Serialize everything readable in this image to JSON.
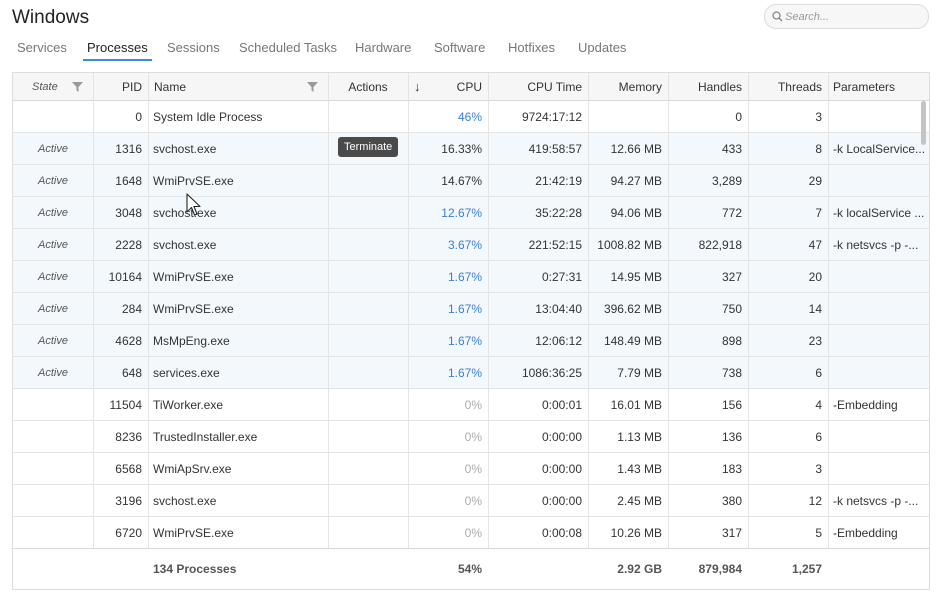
{
  "page": {
    "title": "Windows"
  },
  "search": {
    "placeholder": "Search..."
  },
  "tabs": [
    {
      "label": "Services",
      "active": false
    },
    {
      "label": "Processes",
      "active": true
    },
    {
      "label": "Sessions",
      "active": false
    },
    {
      "label": "Scheduled Tasks",
      "active": false
    },
    {
      "label": "Hardware",
      "active": false
    },
    {
      "label": "Software",
      "active": false
    },
    {
      "label": "Hotfixes",
      "active": false
    },
    {
      "label": "Updates",
      "active": false
    }
  ],
  "table": {
    "headers": {
      "state": "State",
      "pid": "PID",
      "name": "Name",
      "actions": "Actions",
      "sort_indicator": "↓",
      "cpu": "CPU",
      "cpu_time": "CPU Time",
      "memory": "Memory",
      "handles": "Handles",
      "threads": "Threads",
      "parameters": "Parameters"
    },
    "sort": {
      "column": "cpu",
      "direction": "descending"
    },
    "rows": [
      {
        "state": "",
        "pid": "0",
        "name": "System Idle Process",
        "cpu": "46%",
        "cpu_time": "9724:17:12",
        "memory": "",
        "handles": "0",
        "threads": "3",
        "parameters": ""
      },
      {
        "state": "Active",
        "pid": "1316",
        "name": "svchost.exe",
        "cpu": "16.33%",
        "cpu_time": "419:58:57",
        "memory": "12.66 MB",
        "handles": "433",
        "threads": "8",
        "parameters": "-k LocalService..."
      },
      {
        "state": "Active",
        "pid": "1648",
        "name": "WmiPrvSE.exe",
        "cpu": "14.67%",
        "cpu_time": "21:42:19",
        "memory": "94.27 MB",
        "handles": "3,289",
        "threads": "29",
        "parameters": ""
      },
      {
        "state": "Active",
        "pid": "3048",
        "name": "svchost.exe",
        "cpu": "12.67%",
        "cpu_time": "35:22:28",
        "memory": "94.06 MB",
        "handles": "772",
        "threads": "7",
        "parameters": "-k localService ..."
      },
      {
        "state": "Active",
        "pid": "2228",
        "name": "svchost.exe",
        "cpu": "3.67%",
        "cpu_time": "221:52:15",
        "memory": "1008.82 MB",
        "handles": "822,918",
        "threads": "47",
        "parameters": "-k netsvcs -p -..."
      },
      {
        "state": "Active",
        "pid": "10164",
        "name": "WmiPrvSE.exe",
        "cpu": "1.67%",
        "cpu_time": "0:27:31",
        "memory": "14.95 MB",
        "handles": "327",
        "threads": "20",
        "parameters": ""
      },
      {
        "state": "Active",
        "pid": "284",
        "name": "WmiPrvSE.exe",
        "cpu": "1.67%",
        "cpu_time": "13:04:40",
        "memory": "396.62 MB",
        "handles": "750",
        "threads": "14",
        "parameters": ""
      },
      {
        "state": "Active",
        "pid": "4628",
        "name": "MsMpEng.exe",
        "cpu": "1.67%",
        "cpu_time": "12:06:12",
        "memory": "148.49 MB",
        "handles": "898",
        "threads": "23",
        "parameters": ""
      },
      {
        "state": "Active",
        "pid": "648",
        "name": "services.exe",
        "cpu": "1.67%",
        "cpu_time": "1086:36:25",
        "memory": "7.79 MB",
        "handles": "738",
        "threads": "6",
        "parameters": ""
      },
      {
        "state": "",
        "pid": "11504",
        "name": "TiWorker.exe",
        "cpu": "0%",
        "cpu_time": "0:00:01",
        "memory": "16.01 MB",
        "handles": "156",
        "threads": "4",
        "parameters": "-Embedding"
      },
      {
        "state": "",
        "pid": "8236",
        "name": "TrustedInstaller.exe",
        "cpu": "0%",
        "cpu_time": "0:00:00",
        "memory": "1.13 MB",
        "handles": "136",
        "threads": "6",
        "parameters": ""
      },
      {
        "state": "",
        "pid": "6568",
        "name": "WmiApSrv.exe",
        "cpu": "0%",
        "cpu_time": "0:00:00",
        "memory": "1.43 MB",
        "handles": "183",
        "threads": "3",
        "parameters": ""
      },
      {
        "state": "",
        "pid": "3196",
        "name": "svchost.exe",
        "cpu": "0%",
        "cpu_time": "0:00:00",
        "memory": "2.45 MB",
        "handles": "380",
        "threads": "12",
        "parameters": "-k netsvcs -p -..."
      },
      {
        "state": "",
        "pid": "6720",
        "name": "WmiPrvSE.exe",
        "cpu": "0%",
        "cpu_time": "0:00:08",
        "memory": "10.26 MB",
        "handles": "317",
        "threads": "5",
        "parameters": "-Embedding"
      }
    ],
    "footer": {
      "processes": "134 Processes",
      "cpu": "54%",
      "memory": "2.92 GB",
      "handles": "879,984",
      "threads": "1,257"
    }
  },
  "tooltip": {
    "text": "Terminate"
  },
  "colors": {
    "accent": "#3c8ce0",
    "cpu_blue": "#3b7fd0",
    "row_tint": "#f3f8fd"
  }
}
